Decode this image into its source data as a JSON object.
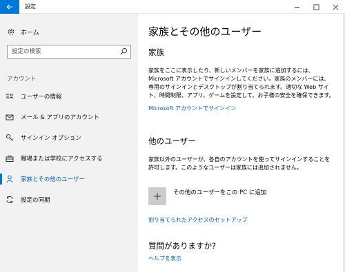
{
  "titlebar": {
    "app_title": "設定"
  },
  "sidebar": {
    "home_label": "ホーム",
    "search_placeholder": "設定の検索",
    "section_label": "アカウント",
    "items": [
      {
        "label": "ユーザーの情報",
        "icon": "user-card-icon"
      },
      {
        "label": "メール & アプリのアカウント",
        "icon": "mail-icon"
      },
      {
        "label": "サインイン オプション",
        "icon": "key-icon"
      },
      {
        "label": "職場または学校にアクセスする",
        "icon": "briefcase-icon"
      },
      {
        "label": "家族とその他のユーザー",
        "icon": "person-icon",
        "active": true
      },
      {
        "label": "設定の同期",
        "icon": "sync-icon"
      }
    ]
  },
  "main": {
    "title": "家族とその他のユーザー",
    "family": {
      "heading": "家族",
      "description": "家族をここに表示したり、新しいメンバーを家族に追加するには、Microsoft アカウントでサインインしてください。家族のメンバーには、専用のサインインとデスクトップが割り当てられます。適切な Web サイト、時間制限、アプリ、ゲームを設定して、お子様の安全を確保できます。",
      "signin_link": "Microsoft アカウントでサインイン"
    },
    "other_users": {
      "heading": "他のユーザー",
      "description": "家族以外のユーザーが、各自のアカウントを使ってサインインすることを許可します。このようなユーザーは家族には追加されません。",
      "add_label": "その他のユーザーをこの PC に追加",
      "assigned_access_link": "割り当てられたアクセスのセットアップ"
    },
    "questions": {
      "heading": "質問がありますか?",
      "help_link": "ヘルプを表示"
    }
  },
  "colors": {
    "accent": "#0078d7",
    "link": "#0063b1",
    "sidebar_bg": "#f2f2f2"
  }
}
